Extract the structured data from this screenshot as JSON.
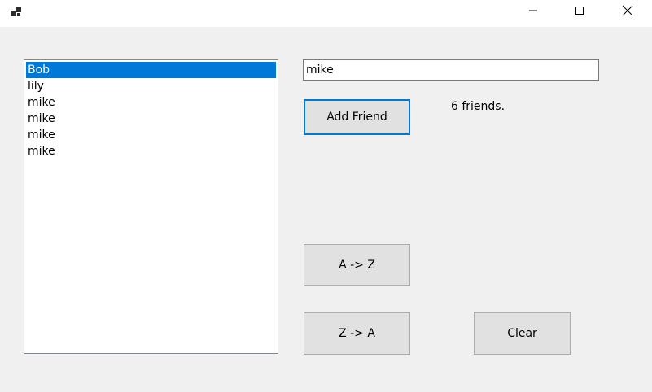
{
  "titlebar": {
    "icons": {
      "app": "app-icon",
      "minimize": "minimize-icon",
      "maximize": "maximize-icon",
      "close": "close-icon"
    }
  },
  "friends_list": {
    "items": [
      {
        "label": "Bob",
        "selected": true
      },
      {
        "label": "lily",
        "selected": false
      },
      {
        "label": "mike",
        "selected": false
      },
      {
        "label": "mike",
        "selected": false
      },
      {
        "label": "mike",
        "selected": false
      },
      {
        "label": "mike",
        "selected": false
      }
    ]
  },
  "name_input": {
    "value": "mike"
  },
  "buttons": {
    "add_friend": "Add Friend",
    "sort_asc": "A -> Z",
    "sort_desc": "Z -> A",
    "clear": "Clear"
  },
  "status": {
    "count_text": "6 friends."
  },
  "colors": {
    "selection": "#0078d7",
    "window_bg": "#f0f0f0",
    "button_bg": "#e1e1e1"
  }
}
